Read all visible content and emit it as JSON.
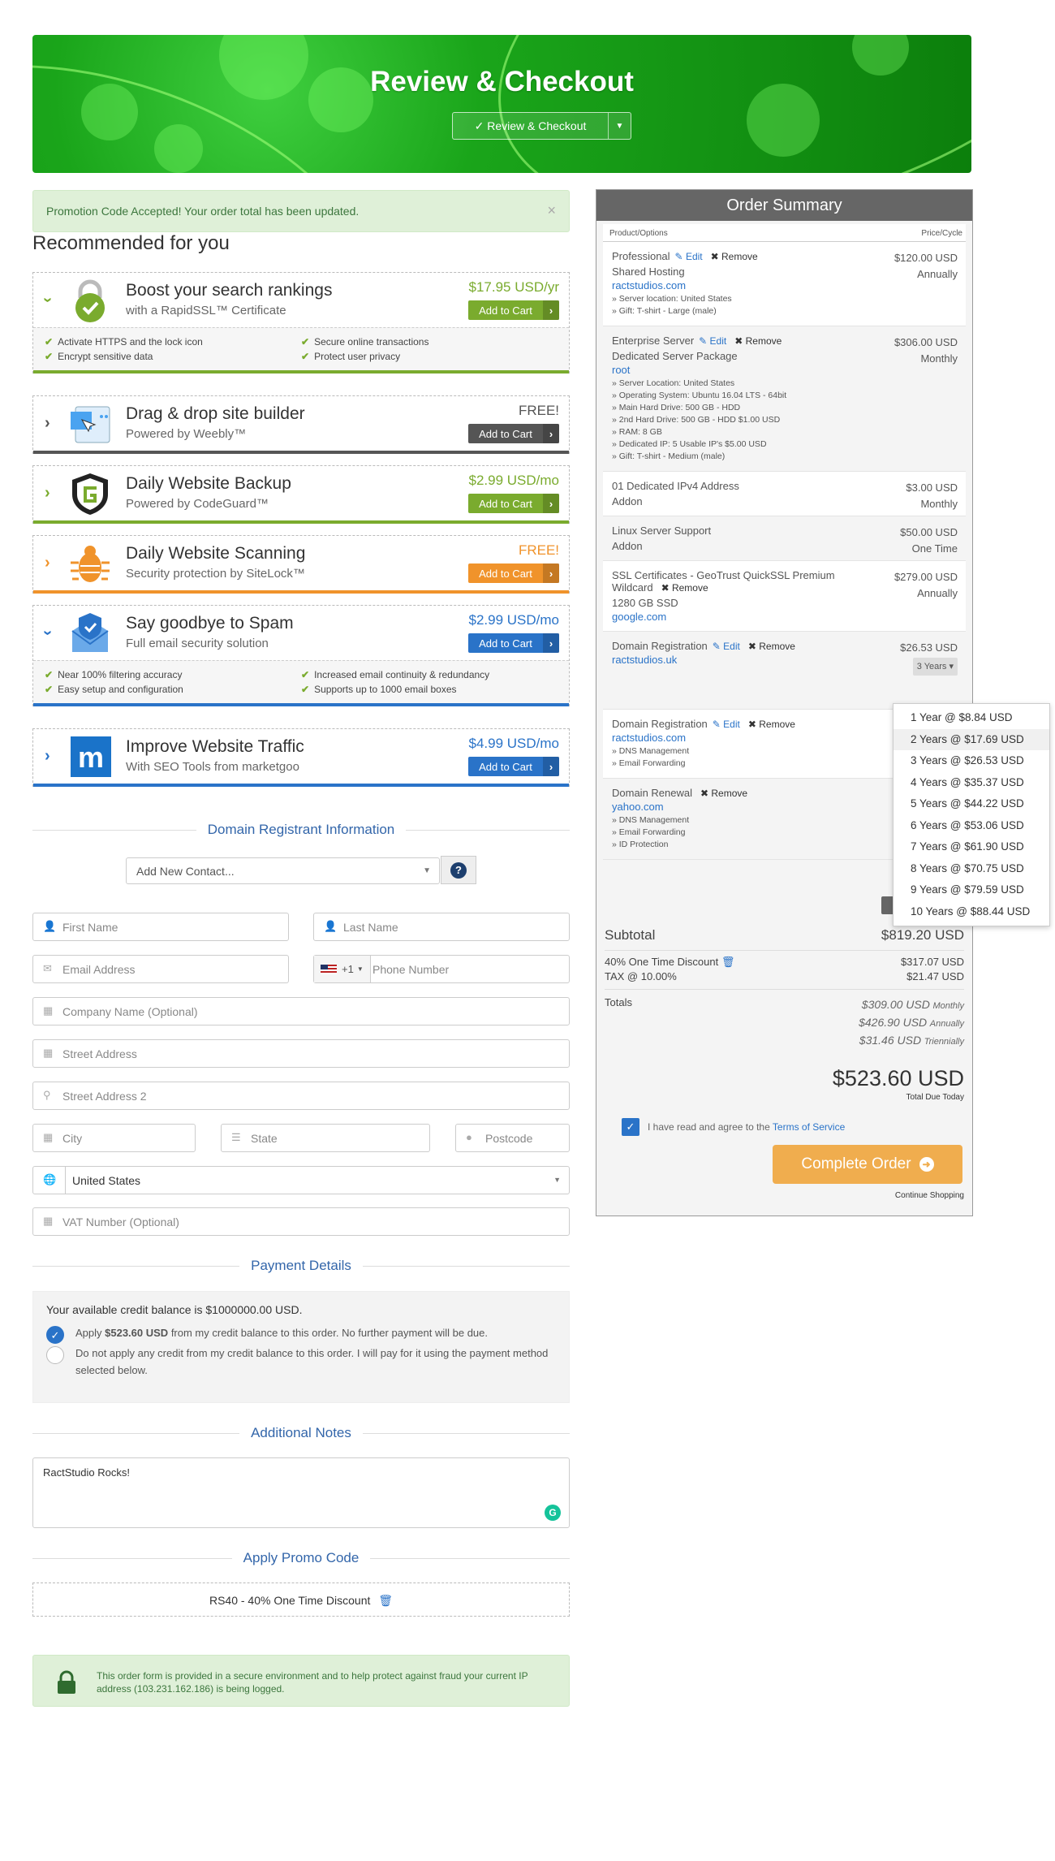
{
  "header": {
    "title": "Review & Checkout",
    "button": "✓ Review & Checkout"
  },
  "alert": {
    "text": "Promotion Code Accepted! Your order total has been updated."
  },
  "recommended": {
    "title": "Recommended for you",
    "items": [
      {
        "title": "Boost your search rankings",
        "subtitle": "with a RapidSSL™ Certificate",
        "price": "$17.95 USD/yr",
        "cart": "Add to Cart",
        "color": "#7aab2e",
        "features": [
          "Activate HTTPS and the lock icon",
          "Secure online transactions",
          "Encrypt sensitive data",
          "Protect user privacy"
        ]
      },
      {
        "title": "Drag & drop site builder",
        "subtitle": "Powered by Weebly™",
        "price": "FREE!",
        "cart": "Add to Cart",
        "color": "#555555"
      },
      {
        "title": "Daily Website Backup",
        "subtitle": "Powered by CodeGuard™",
        "price": "$2.99 USD/mo",
        "cart": "Add to Cart",
        "color": "#7aab2e"
      },
      {
        "title": "Daily Website Scanning",
        "subtitle": "Security protection by SiteLock™",
        "price": "FREE!",
        "cart": "Add to Cart",
        "color": "#f0932b"
      },
      {
        "title": "Say goodbye to Spam",
        "subtitle": "Full email security solution",
        "price": "$2.99 USD/mo",
        "cart": "Add to Cart",
        "color": "#2a73c8",
        "features": [
          "Near 100% filtering accuracy",
          "Increased email continuity & redundancy",
          "Easy setup and configuration",
          "Supports up to 1000 email boxes"
        ]
      },
      {
        "title": "Improve Website Traffic",
        "subtitle": "With SEO Tools from marketgoo",
        "price": "$4.99 USD/mo",
        "cart": "Add to Cart",
        "color": "#2a73c8"
      }
    ]
  },
  "registrant": {
    "title": "Domain Registrant Information",
    "contact": "Add New Contact...",
    "first": "First Name",
    "last": "Last Name",
    "email": "Email Address",
    "dial": "+1",
    "phone": "Phone Number",
    "company": "Company Name (Optional)",
    "street": "Street Address",
    "street2": "Street Address 2",
    "city": "City",
    "state": "State",
    "postcode": "Postcode",
    "country": "United States",
    "vat": "VAT Number (Optional)"
  },
  "payment": {
    "title": "Payment Details",
    "balance": "Your available credit balance is $1000000.00 USD.",
    "apply_pre": "Apply ",
    "apply_amt": "$523.60 USD",
    "apply_post": " from my credit balance to this order. No further payment will be due.",
    "noapply": "Do not apply any credit from my credit balance to this order. I will pay for it using the payment method selected below."
  },
  "notes": {
    "title": "Additional Notes",
    "value": "RactStudio Rocks!"
  },
  "promo": {
    "title": "Apply Promo Code",
    "code": "RS40 - 40% One Time Discount"
  },
  "secure": {
    "text": "This order form is provided in a secure environment and to help protect against fraud your current IP address (103.231.162.186) is being logged."
  },
  "summary": {
    "title": "Order Summary",
    "col1": "Product/Options",
    "col2": "Price/Cycle",
    "edit": "Edit",
    "remove": "Remove",
    "items": [
      {
        "name": "Professional",
        "sub": "Shared Hosting",
        "domain": "ractstudios.com",
        "details": [
          "» Server location: United States",
          "» Gift: T-shirt - Large (male)"
        ],
        "price": "$120.00 USD",
        "cycle": "Annually"
      },
      {
        "name": "Enterprise Server",
        "sub": "Dedicated Server Package",
        "domain": "root",
        "details": [
          "» Server Location: United States",
          "» Operating System: Ubuntu 16.04 LTS - 64bit",
          "» Main Hard Drive: 500 GB - HDD",
          "» 2nd Hard Drive: 500 GB - HDD $1.00 USD",
          "» RAM: 8 GB",
          "» Dedicated IP: 5 Usable IP's $5.00 USD",
          "» Gift: T-shirt - Medium (male)"
        ],
        "price": "$306.00 USD",
        "cycle": "Monthly"
      },
      {
        "name": "01 Dedicated IPv4 Address",
        "sub": "Addon",
        "price": "$3.00 USD",
        "cycle": "Monthly"
      },
      {
        "name": "Linux Server Support",
        "sub": "Addon",
        "price": "$50.00 USD",
        "cycle": "One Time"
      },
      {
        "name": "SSL Certificates - GeoTrust QuickSSL Premium Wildcard",
        "sub": "1280 GB SSD",
        "domain": "google.com",
        "price": "$279.00 USD",
        "cycle": "Annually"
      },
      {
        "name": "Domain Registration",
        "domain": "ractstudios.uk",
        "price": "$26.53 USD",
        "cycle": "3 Years"
      },
      {
        "name": "Domain Registration",
        "domain": "ractstudios.com",
        "details": [
          "» DNS Management",
          "» Email Forwarding"
        ]
      },
      {
        "name": "Domain Renewal",
        "domain": "yahoo.com",
        "details": [
          "» DNS Management",
          "» Email Forwarding",
          "» ID Protection"
        ]
      }
    ],
    "subtotal_label": "Subtotal",
    "subtotal": "$819.20 USD",
    "discount_label": "40% One Time Discount",
    "discount": "$317.07 USD",
    "tax_label": "TAX @ 10.00%",
    "tax": "$21.47 USD",
    "totals_label": "Totals",
    "recurring": [
      {
        "amt": "$309.00 USD",
        "cycle": "Monthly"
      },
      {
        "amt": "$426.90 USD",
        "cycle": "Annually"
      },
      {
        "amt": "$31.46 USD",
        "cycle": "Triennially"
      }
    ],
    "total": "$523.60 USD",
    "total_label": "Total Due Today",
    "tos_pre": "I have read and agree to the ",
    "tos_link": "Terms of Service",
    "complete": "Complete Order",
    "continue": "Continue Shopping"
  },
  "dropdown": [
    "1 Year @ $8.84 USD",
    "2 Years @ $17.69 USD",
    "3 Years @ $26.53 USD",
    "4 Years @ $35.37 USD",
    "5 Years @ $44.22 USD",
    "6 Years @ $53.06 USD",
    "7 Years @ $61.90 USD",
    "8 Years @ $70.75 USD",
    "9 Years @ $79.59 USD",
    "10 Years @ $88.44 USD"
  ]
}
